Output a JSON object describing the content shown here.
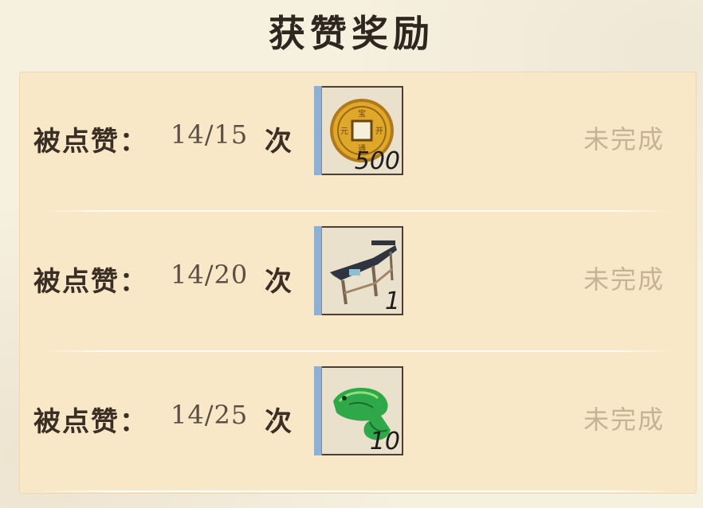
{
  "title": "获赞奖励",
  "rows": [
    {
      "label": "被点赞：",
      "count": "14/15",
      "unit": "次",
      "reward_icon": "copper-coin-icon",
      "qty": "500",
      "status": "未完成"
    },
    {
      "label": "被点赞：",
      "count": "14/20",
      "unit": "次",
      "reward_icon": "pavilion-table-icon",
      "qty": "1",
      "status": "未完成"
    },
    {
      "label": "被点赞：",
      "count": "14/25",
      "unit": "次",
      "reward_icon": "jade-fish-icon",
      "qty": "10",
      "status": "未完成"
    }
  ],
  "colors": {
    "panel": "#f9e8c8",
    "status": "#c8b297",
    "slot_side": "#8fb0d2"
  }
}
